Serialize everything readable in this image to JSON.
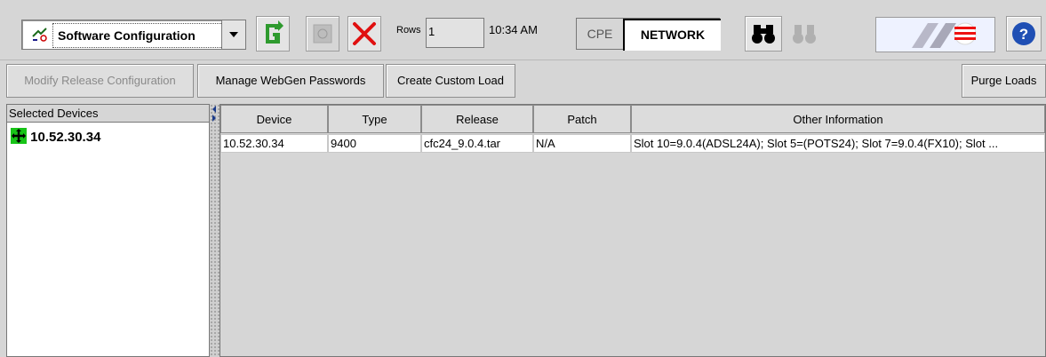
{
  "toolbar": {
    "module_combo": "Software Configuration",
    "rows_label": "Rows",
    "rows_value": "1",
    "clock": "10:34 AM",
    "cpe_label": "CPE",
    "network_label": "NETWORK"
  },
  "actions": {
    "modify_release": "Modify Release Configuration",
    "manage_passwords": "Manage WebGen Passwords",
    "create_custom_load": "Create Custom Load",
    "purge_loads": "Purge Loads"
  },
  "left_panel": {
    "header": "Selected Devices",
    "devices": [
      "10.52.30.34"
    ]
  },
  "table": {
    "columns": [
      "Device",
      "Type",
      "Release",
      "Patch",
      "Other Information"
    ],
    "rows": [
      [
        "10.52.30.34",
        "9400",
        "cfc24_9.0.4.tar",
        "N/A",
        "Slot 10=9.0.4(ADSL24A); Slot 5=(POTS24); Slot 7=9.0.4(FX10); Slot ..."
      ]
    ]
  },
  "icons": {
    "refresh": "refresh-icon",
    "stop": "stop-icon",
    "close": "close-icon",
    "find": "binoculars-icon",
    "find_next": "binoculars-disabled-icon",
    "help": "help-icon"
  },
  "colors": {
    "refresh_green": "#2e9a2e",
    "close_red": "#e01010",
    "help_blue": "#1f4fb4"
  }
}
